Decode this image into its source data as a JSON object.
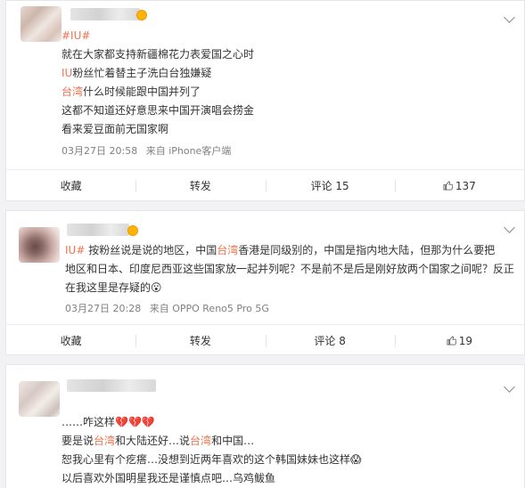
{
  "posts": [
    {
      "lines": [
        [
          "就在大家都支持新疆棉花力表爱国之心时"
        ],
        [
          {
            "hl": "IU"
          },
          "粉丝忙着替主子洗白台独嫌疑"
        ],
        [
          {
            "hl": "台湾"
          },
          "什么时候能跟中国并列了"
        ],
        [
          "这都不知道还好意思来中国开演唱会捞金"
        ],
        [
          "看来爱豆面前无国家啊"
        ]
      ],
      "tag": "#IU#",
      "time": "03月27日 20:58",
      "source": "来自 iPhone客户端",
      "actions": {
        "fav": "收藏",
        "repost": "转发",
        "comment": "评论 15",
        "like": "137"
      }
    },
    {
      "lines": [
        [
          {
            "hl": "IU#"
          },
          " 按粉丝说是说的地区，中国",
          {
            "hl": "台湾"
          },
          "香港是同级别的，中国是指内地大陆，但那为什么要把"
        ],
        [
          "地区和日本、印度尼西亚这些国家放一起并列呢？不是前不是后是刚好放两个国家之间呢？反正"
        ],
        [
          "在我这里是存疑的",
          {
            "emoji": "😮"
          }
        ]
      ],
      "time": "03月27日 20:28",
      "source": "来自 OPPO Reno5 Pro 5G",
      "actions": {
        "fav": "收藏",
        "repost": "转发",
        "comment": "评论 8",
        "like": "19"
      }
    },
    {
      "lines": [
        [
          "……咋这样",
          {
            "emoji": "💔💔💔"
          }
        ],
        [
          "要是说",
          {
            "hl": "台湾"
          },
          "和大陆还好…说",
          {
            "hl": "台湾"
          },
          "和中国…"
        ],
        [
          "恕我心里有个疙瘩…没想到近两年喜欢的这个韩国妹妹也这样",
          {
            "emoji": "😱"
          }
        ],
        [
          "以后喜欢外国明星我还是谨慎点吧…乌鸡鲅鱼"
        ]
      ]
    }
  ]
}
